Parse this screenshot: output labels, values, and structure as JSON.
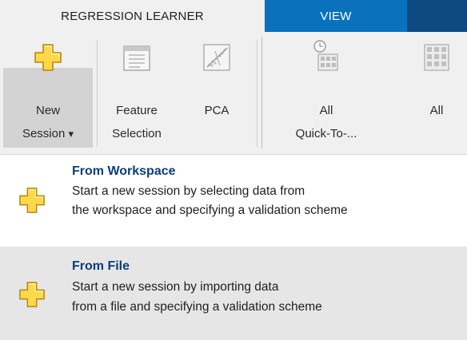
{
  "tabs": {
    "active": "REGRESSION LEARNER",
    "view": "VIEW"
  },
  "toolstrip": {
    "new_session": {
      "line1": "New",
      "line2": "Session",
      "arrow": "▾",
      "icon": "plus-icon"
    },
    "feature_selection": {
      "line1": "Feature",
      "line2": "Selection",
      "icon": "feature-selection-icon"
    },
    "pca": {
      "label": "PCA",
      "icon": "pca-icon"
    },
    "all_quick": {
      "line1": "All",
      "line2": "Quick-To-...",
      "icon": "all-quick-icon"
    },
    "all": {
      "label": "All",
      "icon": "all-models-icon"
    }
  },
  "menu": {
    "items": [
      {
        "title": "From Workspace",
        "desc1": "Start a new session by selecting data from",
        "desc2": "the workspace and specifying a validation scheme",
        "icon": "plus-icon"
      },
      {
        "title": "From File",
        "desc1": "Start a new session by importing data",
        "desc2": "from a file and specifying a validation scheme",
        "icon": "plus-icon"
      }
    ]
  },
  "colors": {
    "accent_blue": "#0a72bd",
    "plus_yellow": "#ffd94a",
    "title_blue": "#0d3e78"
  }
}
